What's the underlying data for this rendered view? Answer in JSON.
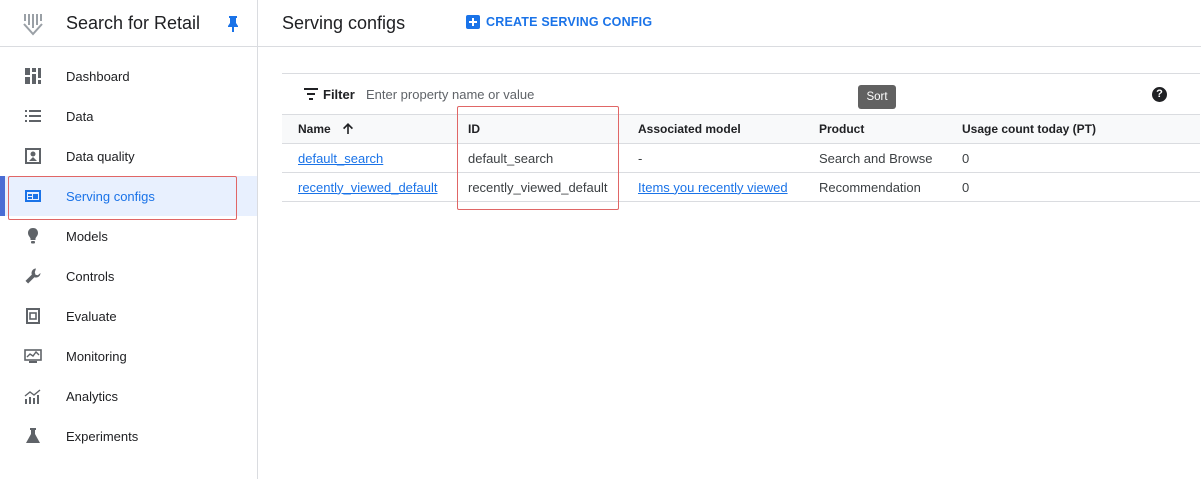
{
  "sidebar": {
    "product_title": "Search for Retail",
    "items": [
      {
        "label": "Dashboard",
        "icon": "dashboard-icon"
      },
      {
        "label": "Data",
        "icon": "list-icon"
      },
      {
        "label": "Data quality",
        "icon": "data-quality-icon"
      },
      {
        "label": "Serving configs",
        "icon": "serving-configs-icon",
        "active": true
      },
      {
        "label": "Models",
        "icon": "lightbulb-icon"
      },
      {
        "label": "Controls",
        "icon": "wrench-icon"
      },
      {
        "label": "Evaluate",
        "icon": "evaluate-icon"
      },
      {
        "label": "Monitoring",
        "icon": "monitoring-icon"
      },
      {
        "label": "Analytics",
        "icon": "analytics-icon"
      },
      {
        "label": "Experiments",
        "icon": "flask-icon"
      }
    ]
  },
  "header": {
    "title": "Serving configs",
    "create_label": "CREATE SERVING CONFIG"
  },
  "filter": {
    "label": "Filter",
    "placeholder": "Enter property name or value"
  },
  "tooltip": {
    "sort": "Sort"
  },
  "table": {
    "columns": [
      "Name",
      "ID",
      "Associated model",
      "Product",
      "Usage count today (PT)"
    ],
    "rows": [
      {
        "name": "default_search",
        "id": "default_search",
        "model": "-",
        "product": "Search and Browse",
        "usage": "0"
      },
      {
        "name": "recently_viewed_default",
        "id": "recently_viewed_default",
        "model": "Items you recently viewed",
        "product": "Recommendation",
        "usage": "0"
      }
    ]
  },
  "colors": {
    "accent": "#1a73e8",
    "active_bg": "#e8f0fe",
    "highlight": "#e06666"
  }
}
